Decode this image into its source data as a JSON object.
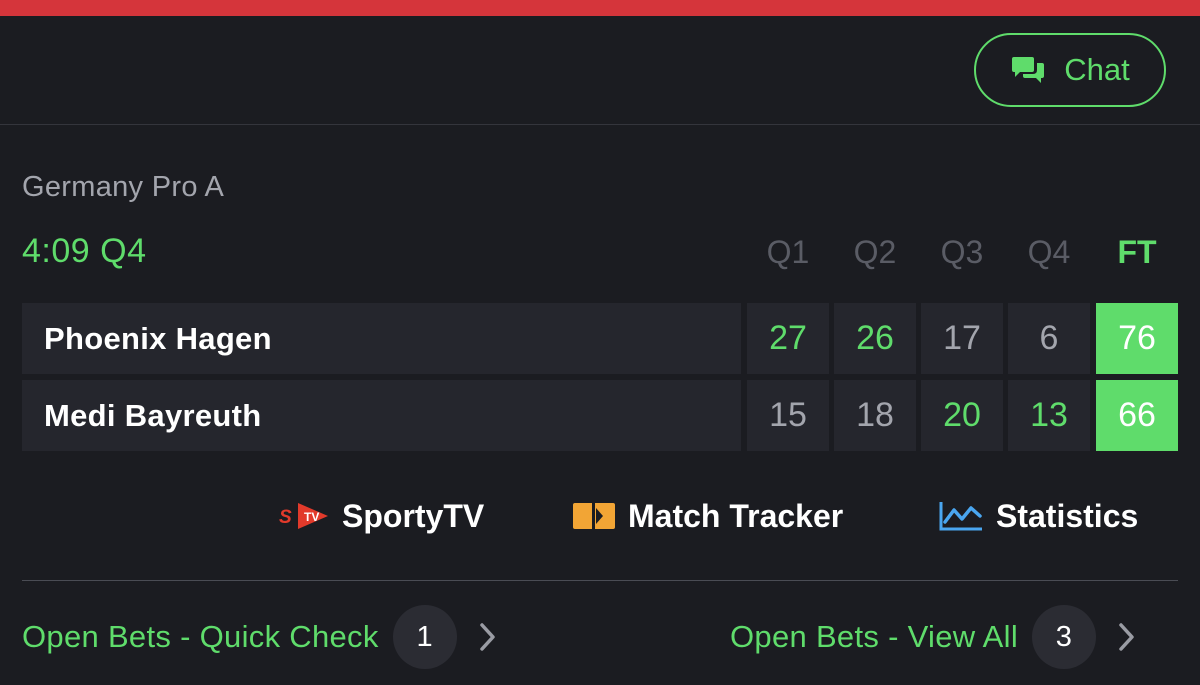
{
  "header": {
    "chat_label": "Chat"
  },
  "match": {
    "league": "Germany Pro A",
    "clock": "4:09 Q4",
    "columns": [
      "Q1",
      "Q2",
      "Q3",
      "Q4",
      "FT"
    ],
    "teams": [
      {
        "name": "Phoenix Hagen",
        "q1": "27",
        "q2": "26",
        "q3": "17",
        "q4": "6",
        "ft": "76"
      },
      {
        "name": "Medi Bayreuth",
        "q1": "15",
        "q2": "18",
        "q3": "20",
        "q4": "13",
        "ft": "66"
      }
    ]
  },
  "links": {
    "sportytv_label": "SportyTV",
    "match_tracker_label": "Match Tracker",
    "statistics_label": "Statistics",
    "sportytv_icon": "sportytv-logo-icon",
    "match_tracker_icon": "match-tracker-icon",
    "statistics_icon": "line-chart-icon"
  },
  "bets": {
    "quick_check_label": "Open Bets - Quick Check",
    "quick_check_count": "1",
    "view_all_label": "Open Bets - View All",
    "view_all_count": "3"
  },
  "colors": {
    "accent_green": "#5fdc6b",
    "top_bar_red": "#d5353b",
    "background": "#1b1c21",
    "cell_background": "#25262d",
    "muted_text": "#a3a5ad"
  }
}
